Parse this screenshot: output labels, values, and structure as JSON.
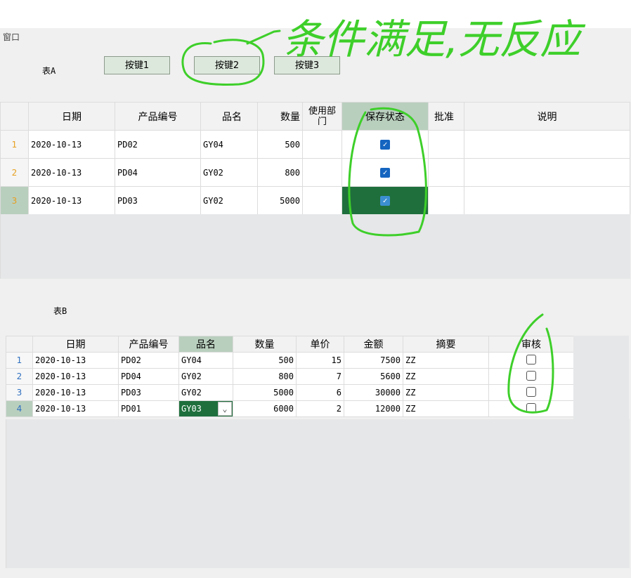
{
  "window": {
    "title": "窗口"
  },
  "section_a": {
    "label": "表A",
    "buttons": [
      "按键1",
      "按键2",
      "按键3"
    ],
    "columns": [
      "",
      "日期",
      "产品编号",
      "品名",
      "数量",
      "使用部门",
      "保存状态",
      "批准",
      "说明"
    ],
    "rows": [
      {
        "no": "1",
        "date": "2020-10-13",
        "code": "PD02",
        "name": "GY04",
        "qty": "500",
        "dept": "",
        "saved": true,
        "approve": "",
        "note": ""
      },
      {
        "no": "2",
        "date": "2020-10-13",
        "code": "PD04",
        "name": "GY02",
        "qty": "800",
        "dept": "",
        "saved": true,
        "approve": "",
        "note": ""
      },
      {
        "no": "3",
        "date": "2020-10-13",
        "code": "PD03",
        "name": "GY02",
        "qty": "5000",
        "dept": "",
        "saved": true,
        "approve": "",
        "note": ""
      }
    ],
    "selected_row": 3
  },
  "section_b": {
    "label": "表B",
    "columns": [
      "",
      "日期",
      "产品编号",
      "品名",
      "数量",
      "单价",
      "金额",
      "摘要",
      "审核"
    ],
    "rows": [
      {
        "no": "1",
        "date": "2020-10-13",
        "code": "PD02",
        "name": "GY04",
        "qty": "500",
        "price": "15",
        "amount": "7500",
        "summary": "ZZ",
        "audit": false
      },
      {
        "no": "2",
        "date": "2020-10-13",
        "code": "PD04",
        "name": "GY02",
        "qty": "800",
        "price": "7",
        "amount": "5600",
        "summary": "ZZ",
        "audit": false
      },
      {
        "no": "3",
        "date": "2020-10-13",
        "code": "PD03",
        "name": "GY02",
        "qty": "5000",
        "price": "6",
        "amount": "30000",
        "summary": "ZZ",
        "audit": false
      },
      {
        "no": "4",
        "date": "2020-10-13",
        "code": "PD01",
        "name": "GY03",
        "qty": "6000",
        "price": "2",
        "amount": "12000",
        "summary": "ZZ",
        "audit": false
      }
    ],
    "selected_row": 4
  },
  "annotation": {
    "text": "条件满足,无反应",
    "color": "#3ecf2a"
  }
}
